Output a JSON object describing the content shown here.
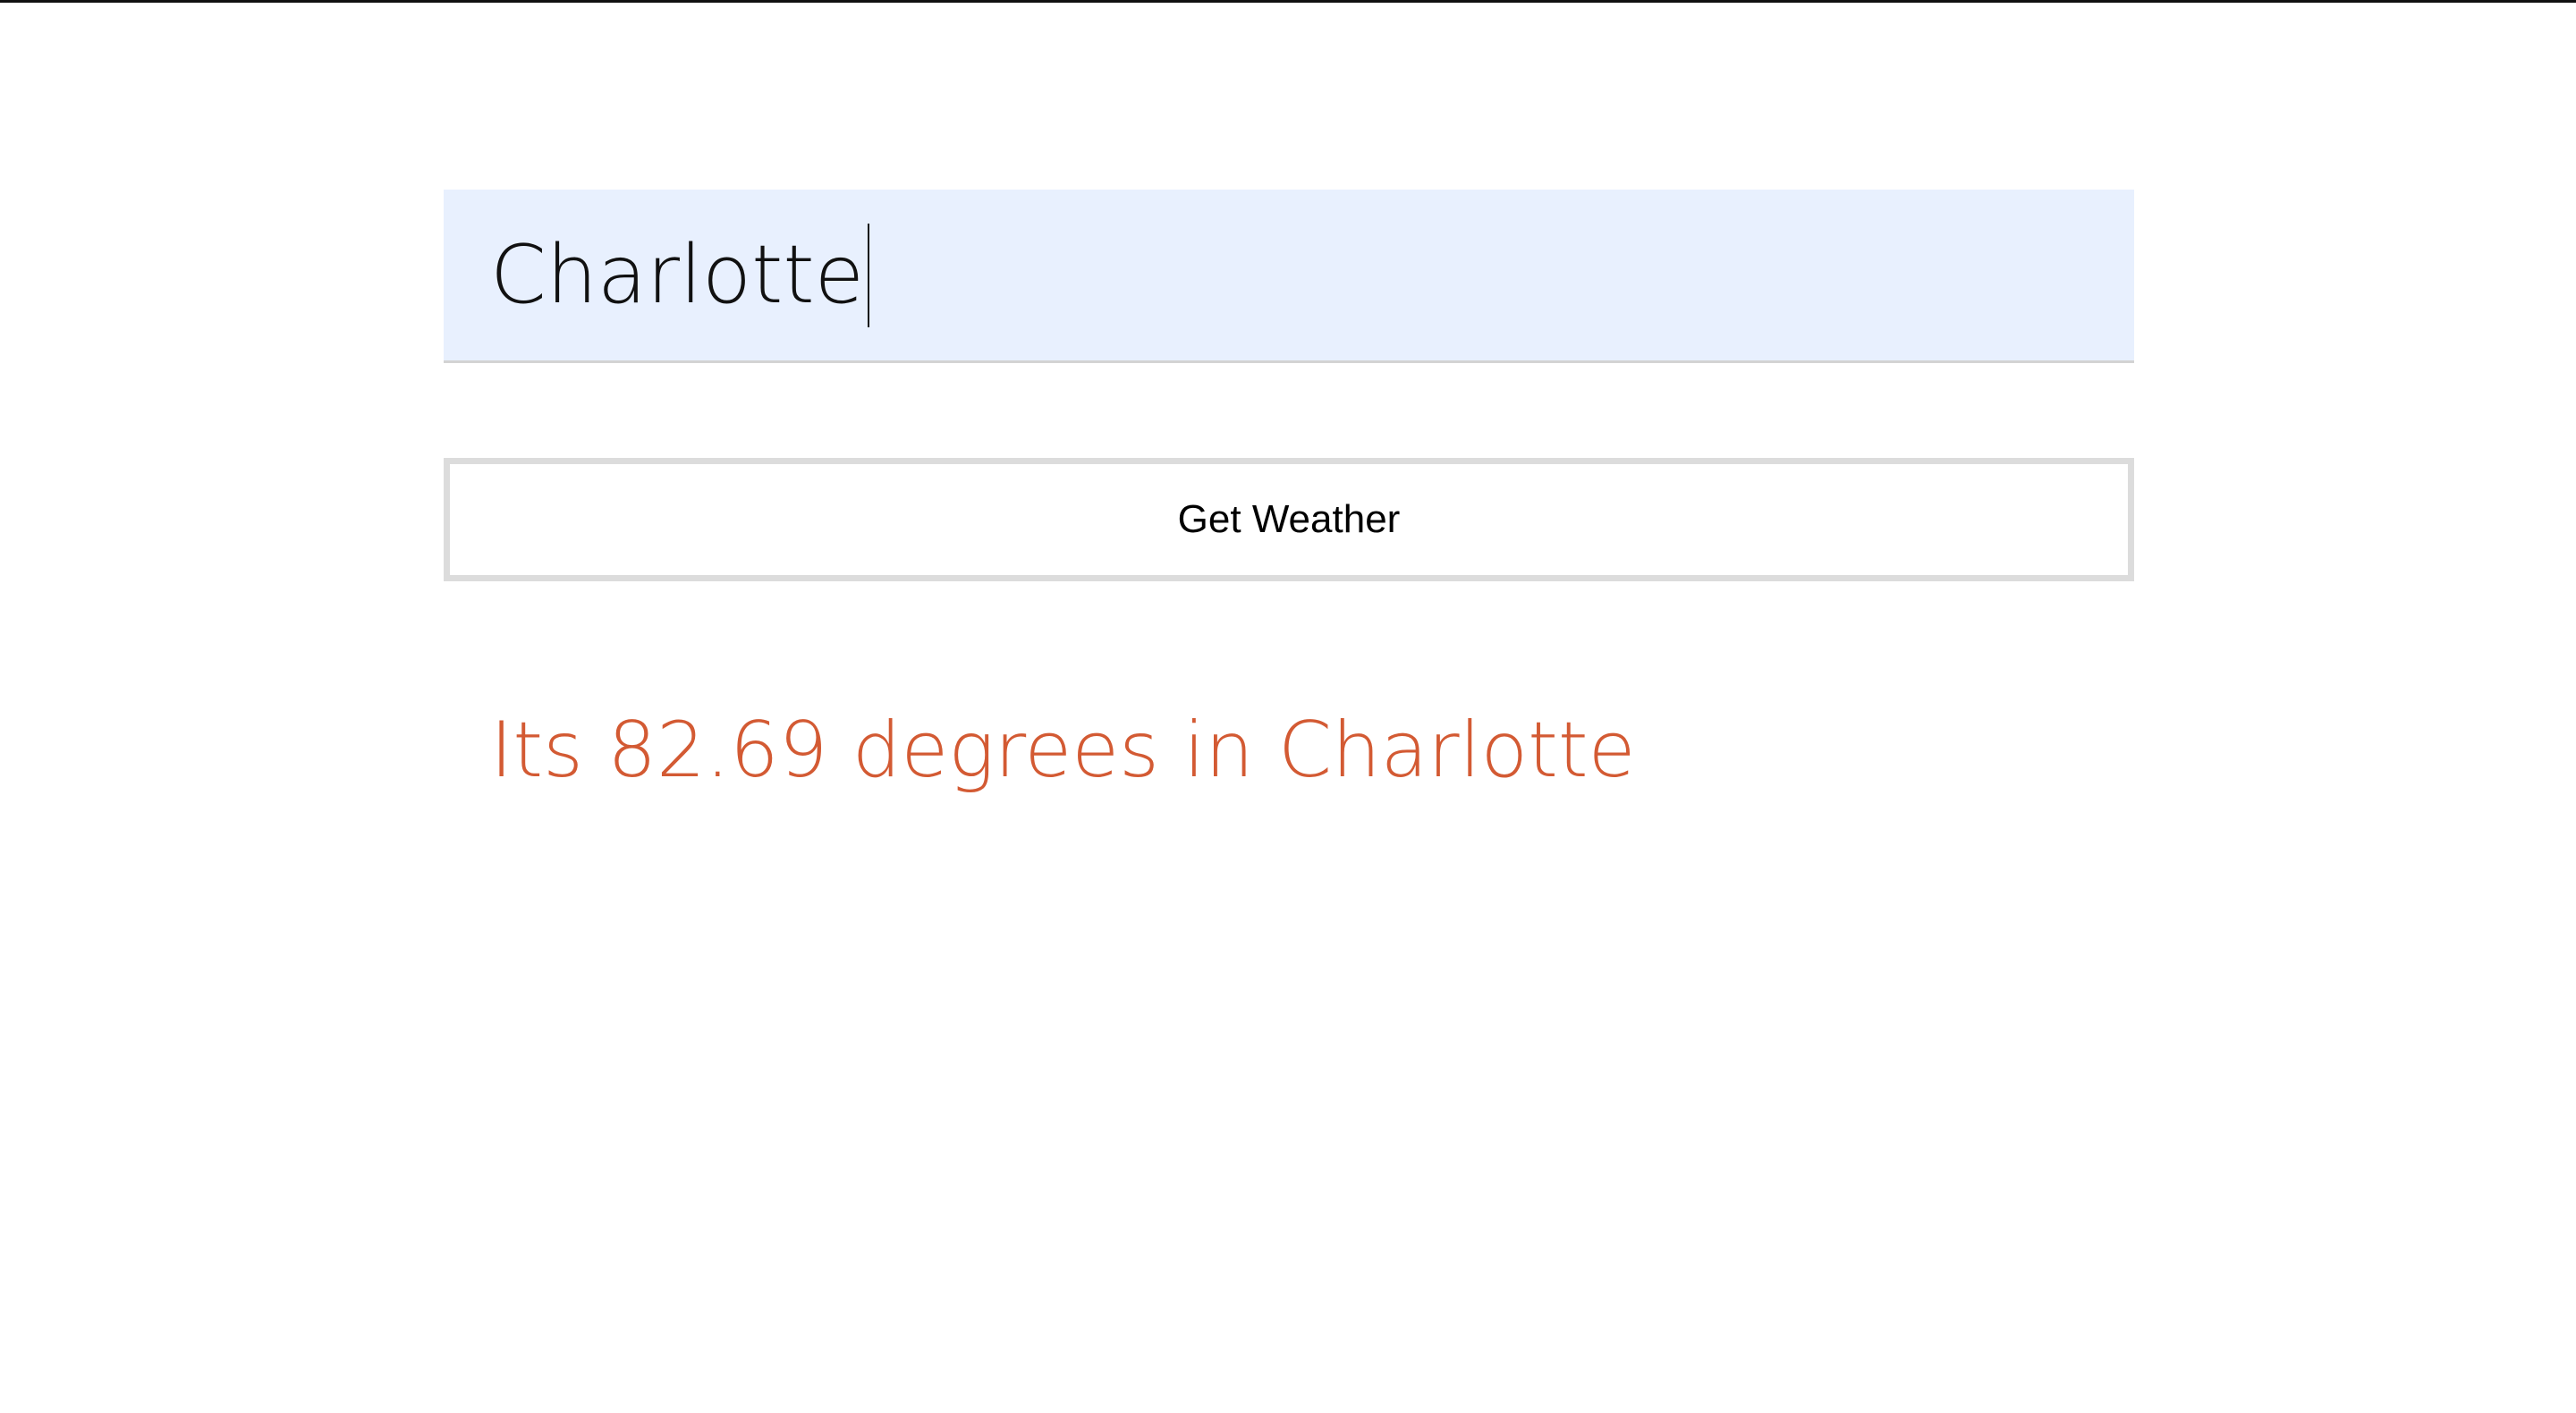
{
  "search": {
    "value": "Charlotte"
  },
  "actions": {
    "get_weather_label": "Get Weather"
  },
  "result": {
    "text": "Its 82.69 degrees in Charlotte",
    "color": "#d35a33"
  }
}
